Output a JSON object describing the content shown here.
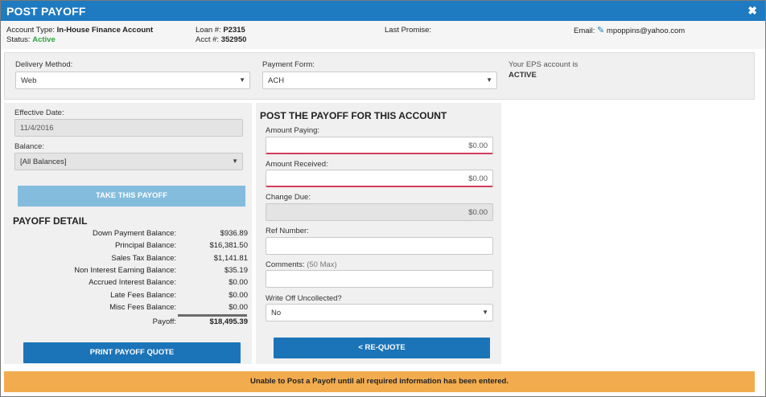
{
  "header": {
    "title": "POST PAYOFF",
    "close_icon": "close-icon"
  },
  "account": {
    "type_label": "Account Type:",
    "type_value": "In-House Finance Account",
    "status_label": "Status:",
    "status_value": "Active",
    "loan_label": "Loan #:",
    "loan_value": "P2315",
    "acct_label": "Acct #:",
    "acct_value": "352950",
    "last_promise_label": "Last Promise:",
    "email_label": "Email:",
    "email_icon": "edit-icon",
    "email_value": "mpoppins@yahoo.com"
  },
  "delivery": {
    "method_label": "Delivery Method:",
    "method_value": "Web",
    "payment_form_label": "Payment Form:",
    "payment_form_value": "ACH",
    "eps_label": "Your EPS account is",
    "eps_status": "ACTIVE"
  },
  "left": {
    "effective_date_label": "Effective Date:",
    "effective_date_value": "11/4/2016",
    "balance_label": "Balance:",
    "balance_value": "[All Balances]",
    "take_payoff_label": "TAKE THIS PAYOFF",
    "detail_title": "PAYOFF DETAIL",
    "details": [
      {
        "label": "Down Payment Balance:",
        "value": "$936.89"
      },
      {
        "label": "Principal Balance:",
        "value": "$16,381.50"
      },
      {
        "label": "Sales Tax Balance:",
        "value": "$1,141.81"
      },
      {
        "label": "Non Interest Earning Balance:",
        "value": "$35.19"
      },
      {
        "label": "Accrued Interest Balance:",
        "value": "$0.00"
      },
      {
        "label": "Late Fees Balance:",
        "value": "$0.00"
      },
      {
        "label": "Misc Fees Balance:",
        "value": "$0.00"
      }
    ],
    "payoff_label": "Payoff:",
    "payoff_value": "$18,495.39",
    "print_quote_label": "PRINT PAYOFF QUOTE"
  },
  "right": {
    "title": "POST THE PAYOFF FOR THIS ACCOUNT",
    "amount_paying_label": "Amount Paying:",
    "amount_paying_value": "$0.00",
    "amount_received_label": "Amount Received:",
    "amount_received_value": "$0.00",
    "change_due_label": "Change Due:",
    "change_due_value": "$0.00",
    "ref_number_label": "Ref Number:",
    "ref_number_value": "",
    "comments_label": "Comments:",
    "comments_hint": "(50 Max)",
    "comments_value": "",
    "write_off_label": "Write Off Uncollected?",
    "write_off_value": "No",
    "requote_label": "< RE-QUOTE"
  },
  "footer": {
    "warning": "Unable to Post a Payoff until all required information has been entered."
  },
  "colors": {
    "titlebar": "#1f7bc1",
    "primary_button": "#1c74b8",
    "disabled_button": "#83bcdd",
    "active_green": "#2fa43a",
    "warning": "#f2ac4f",
    "required_underline": "#d23c5c"
  }
}
